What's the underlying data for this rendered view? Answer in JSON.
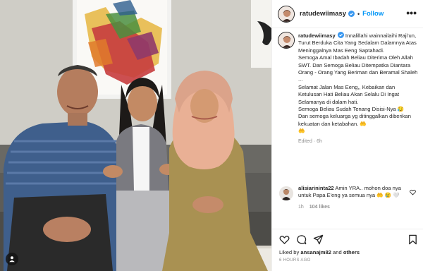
{
  "post": {
    "username": "ratudewiimasy",
    "follow_label": "Follow",
    "more_label": "•••",
    "caption_lines": [
      "Innalillahi wainnailaihi Raji'un, Turut Berduka Cita Yang Sedalam Dalamnya Atas Meninggalnya Mas Eeng Saptahadi.",
      "Semoga Amal Ibadah Beliau Diterima Oleh Allah SWT. Dan Semoga Beliau Ditempatka Diantara Orang - Orang Yang Beriman dan Beramal Shaleh ...",
      "Selamat Jalan Mas Eeng,, Kebaikan dan Ketulusan Hati Beliau Akan Selalu Di Ingat Selamanya di dalam hati.",
      "Semoga Beliau Sudah Tenang Disisi-Nya 😥",
      "Dan semoga keluarga yg ditinggalkan diberikan kekuatan dan ketabahan. 🤲",
      "🤲"
    ],
    "edited_label": "Edited · 6h"
  },
  "comment": {
    "username": "alisiarininta22",
    "text": "Amin YRA.. mohon doa nya untuk Papa E'eng ya semua nya 🤲 😢 🤍",
    "time": "1h",
    "likes": "104 likes"
  },
  "footer": {
    "liked_by_prefix": "Liked by",
    "liked_by_user": "ansanajm82",
    "liked_by_suffix": "and others",
    "time_ago": "6 HOURS AGO"
  },
  "colors": {
    "accent": "#0095f6",
    "text": "#262626",
    "muted": "#8e8e8e",
    "verified": "#3897f0"
  }
}
